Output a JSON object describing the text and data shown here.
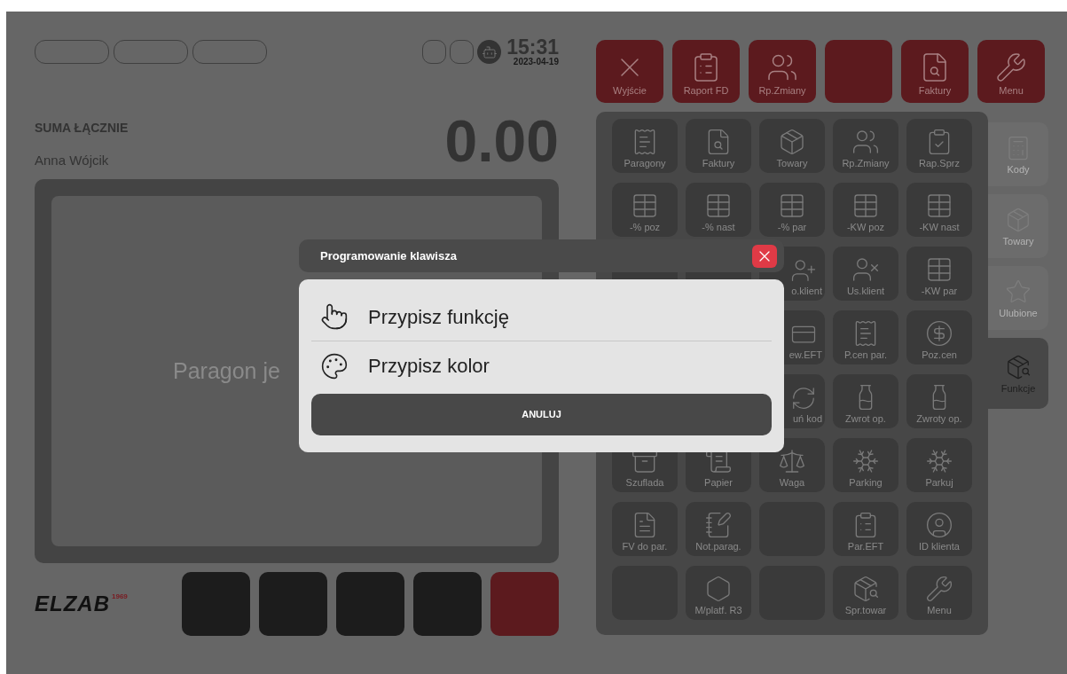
{
  "status": {
    "time": "15:31",
    "date": "2023-04-19"
  },
  "total": {
    "label": "SUMA ŁĄCZNIE",
    "amount": "0.00"
  },
  "cashier": "Anna Wójcik",
  "receipt": {
    "message": "Paragon je"
  },
  "logo": {
    "name": "ELZAB",
    "year": "1969"
  },
  "quick_keys": [
    {
      "color": "#1c1c1c"
    },
    {
      "color": "#1c1c1c"
    },
    {
      "color": "#1c1c1c"
    },
    {
      "color": "#1c1c1c"
    },
    {
      "color": "#5c1a1e"
    }
  ],
  "top_buttons": [
    {
      "kind": "key",
      "label": "Wyjście"
    },
    {
      "kind": "key",
      "label": "Raport FD"
    },
    {
      "kind": "key",
      "label": "Rp.Zmiany"
    },
    {
      "kind": "blank"
    },
    {
      "kind": "key",
      "label": "Faktury"
    },
    {
      "kind": "key",
      "label": "Menu"
    }
  ],
  "grid": [
    {
      "kind": "key",
      "label": "Paragony"
    },
    {
      "kind": "key",
      "label": "Faktury"
    },
    {
      "kind": "key",
      "label": "Towary"
    },
    {
      "kind": "key",
      "label": "Rp.Zmiany"
    },
    {
      "kind": "key",
      "label": "Rap.Sprz"
    },
    {
      "kind": "key",
      "label": "-% poz"
    },
    {
      "kind": "key",
      "label": "-% nast"
    },
    {
      "kind": "key",
      "label": "-% par"
    },
    {
      "kind": "key",
      "label": "-KW poz"
    },
    {
      "kind": "key",
      "label": "-KW nast"
    },
    {
      "kind": "blank"
    },
    {
      "kind": "blank"
    },
    {
      "kind": "partial",
      "label": "o.klient"
    },
    {
      "kind": "key",
      "label": "Us.klient"
    },
    {
      "kind": "key",
      "label": "-KW par"
    },
    {
      "kind": "blank"
    },
    {
      "kind": "blank"
    },
    {
      "kind": "partial",
      "label": "ew.EFT"
    },
    {
      "kind": "key",
      "label": "P.cen par."
    },
    {
      "kind": "key",
      "label": "Poz.cen"
    },
    {
      "kind": "blank"
    },
    {
      "kind": "blank"
    },
    {
      "kind": "partial",
      "label": "uń kod"
    },
    {
      "kind": "key",
      "label": "Zwrot op."
    },
    {
      "kind": "key",
      "label": "Zwroty op."
    },
    {
      "kind": "key",
      "label": "Szuflada"
    },
    {
      "kind": "key",
      "label": "Papier"
    },
    {
      "kind": "key",
      "label": "Waga"
    },
    {
      "kind": "key",
      "label": "Parking"
    },
    {
      "kind": "key",
      "label": "Parkuj"
    },
    {
      "kind": "key",
      "label": "FV do par."
    },
    {
      "kind": "key",
      "label": "Not.parag."
    },
    {
      "kind": "blank"
    },
    {
      "kind": "key",
      "label": "Par.EFT"
    },
    {
      "kind": "key",
      "label": "ID klienta"
    },
    {
      "kind": "blank"
    },
    {
      "kind": "key",
      "label": "M/platf. R3"
    },
    {
      "kind": "blank"
    },
    {
      "kind": "key",
      "label": "Spr.towar"
    },
    {
      "kind": "key",
      "label": "Menu"
    }
  ],
  "tabs": [
    {
      "label": "Kody",
      "selected": false
    },
    {
      "label": "Towary",
      "selected": false
    },
    {
      "label": "Ulubione",
      "selected": false
    },
    {
      "label": "Funkcje",
      "selected": true
    }
  ],
  "dialog": {
    "title": "Programowanie klawisza",
    "options": [
      {
        "label": "Przypisz funkcję"
      },
      {
        "label": "Przypisz kolor"
      }
    ],
    "cancel": "ANULUJ"
  }
}
